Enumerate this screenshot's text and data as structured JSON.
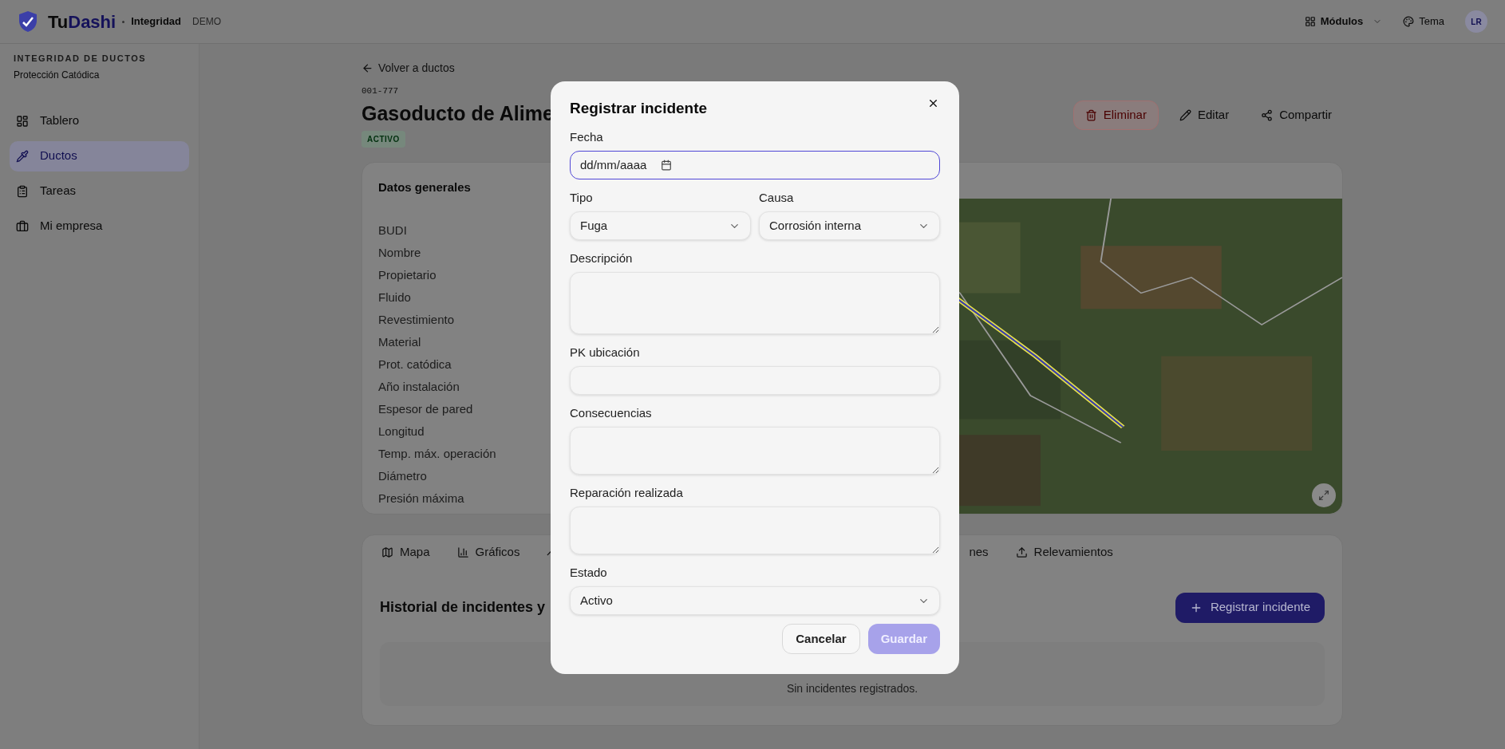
{
  "header": {
    "brand_first": "Tu",
    "brand_second": "Dashi",
    "module": "Integridad",
    "badge": "DEMO",
    "modules_button": "Módulos",
    "theme_button": "Tema",
    "avatar": "LR"
  },
  "sidebar": {
    "section_title": "INTEGRIDAD DE DUCTOS",
    "section_subtitle": "Protección Catódica",
    "items": [
      {
        "label": "Tablero",
        "selected": false
      },
      {
        "label": "Ductos",
        "selected": true
      },
      {
        "label": "Tareas",
        "selected": false
      },
      {
        "label": "Mi empresa",
        "selected": false
      }
    ]
  },
  "page": {
    "back_link": "Volver a ductos",
    "code": "001-777",
    "title": "Gasoducto de Alime",
    "status": "ACTIVO",
    "actions": [
      {
        "label": "Eliminar",
        "kind": "danger"
      },
      {
        "label": "Editar",
        "kind": "plain"
      },
      {
        "label": "Compartir",
        "kind": "plain"
      }
    ],
    "general_card": {
      "title": "Datos generales",
      "fields": [
        "BUDI",
        "Nombre",
        "Propietario",
        "Fluido",
        "Revestimiento",
        "Material",
        "Prot. catódica",
        "Año instalación",
        "Espesor de pared",
        "Longitud",
        "Temp. máx. operación",
        "Diámetro",
        "Presión máxima"
      ]
    },
    "tabs": [
      {
        "label": "Mapa",
        "selected": false
      },
      {
        "label": "Gráficos",
        "selected": false
      },
      {
        "selected": false
      },
      {
        "label": "nes",
        "selected": false
      },
      {
        "label": "Relevamientos",
        "selected": false
      }
    ],
    "incidents": {
      "title": "Historial de incidentes y",
      "register_button": "Registrar incidente",
      "empty_text": "Sin incidentes registrados."
    }
  },
  "dialog": {
    "title": "Registrar incidente",
    "fields": [
      {
        "kind": "date",
        "label": "Fecha",
        "placeholder": "dd/mm/aaaa",
        "focused": true
      },
      {
        "kind": "select_pair",
        "items": [
          {
            "label": "Tipo",
            "value": "Fuga"
          },
          {
            "label": "Causa",
            "value": "Corrosión interna"
          }
        ]
      },
      {
        "kind": "textarea_large",
        "label": "Descripción"
      },
      {
        "kind": "input",
        "label": "PK ubicación"
      },
      {
        "kind": "textarea",
        "label": "Consecuencias"
      },
      {
        "kind": "textarea",
        "label": "Reparación realizada"
      },
      {
        "kind": "select",
        "label": "Estado",
        "value": "Activo"
      }
    ],
    "buttons": [
      {
        "label": "Cancelar",
        "kind": "secondary",
        "disabled": false
      },
      {
        "label": "Guardar",
        "kind": "primary",
        "disabled": true
      }
    ]
  }
}
